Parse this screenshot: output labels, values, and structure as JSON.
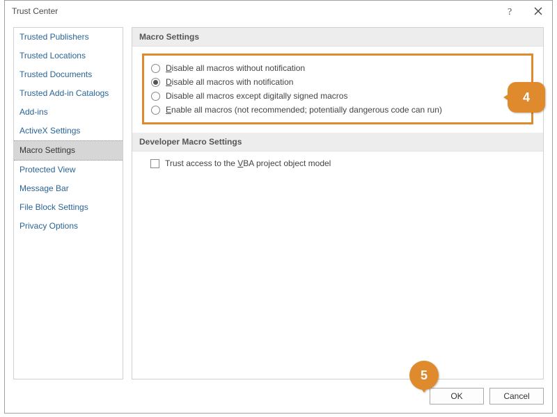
{
  "dialog": {
    "title": "Trust Center"
  },
  "sidebar": {
    "items": [
      {
        "label": "Trusted Publishers"
      },
      {
        "label": "Trusted Locations"
      },
      {
        "label": "Trusted Documents"
      },
      {
        "label": "Trusted Add-in Catalogs"
      },
      {
        "label": "Add-ins"
      },
      {
        "label": "ActiveX Settings"
      },
      {
        "label": "Macro Settings",
        "selected": true
      },
      {
        "label": "Protected View"
      },
      {
        "label": "Message Bar"
      },
      {
        "label": "File Block Settings"
      },
      {
        "label": "Privacy Options"
      }
    ]
  },
  "main": {
    "section1_title": "Macro Settings",
    "radios": [
      {
        "prefix": "",
        "mnemonic": "D",
        "rest": "isable all macros without notification",
        "checked": false
      },
      {
        "prefix": "",
        "mnemonic": "D",
        "rest": "isable all macros with notification",
        "checked": true
      },
      {
        "prefix": "Disable all macros except digitally signed macros",
        "mnemonic": "",
        "rest": "",
        "checked": false
      },
      {
        "prefix": "",
        "mnemonic": "E",
        "rest": "nable all macros (not recommended; potentially dangerous code can run)",
        "checked": false
      }
    ],
    "section2_title": "Developer Macro Settings",
    "checkbox": {
      "prefix": "Trust access to the ",
      "mnemonic": "V",
      "rest": "BA project object model",
      "checked": false
    }
  },
  "callouts": {
    "c4": "4",
    "c5": "5"
  },
  "footer": {
    "ok": "OK",
    "cancel": "Cancel"
  }
}
